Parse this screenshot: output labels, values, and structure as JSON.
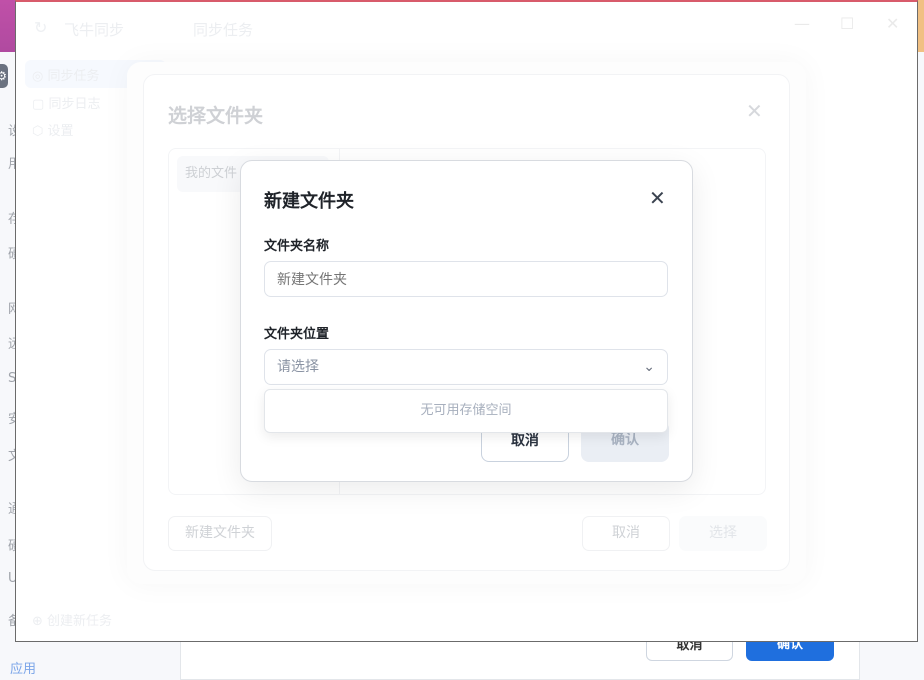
{
  "desktop": {
    "side_chars": [
      "设",
      "用",
      "存",
      "硬",
      "网",
      "远",
      "S",
      "安",
      "文",
      "通",
      "硬",
      "U",
      "备"
    ],
    "gear_icon": "gear-icon",
    "app_link": "应用",
    "back_dialog": {
      "cancel": "取消",
      "confirm": "确认"
    },
    "accent": "#1f6fde"
  },
  "window": {
    "app_name": "飞牛同步",
    "page_title": "同步任务",
    "controls": {
      "minimize": "—",
      "maximize": "☐",
      "close": "✕"
    },
    "sidebar": [
      {
        "label": "同步任务",
        "icon": "◎"
      },
      {
        "label": "同步日志",
        "icon": "▢"
      },
      {
        "label": "设置",
        "icon": "⬡"
      }
    ],
    "create_task": "创建新任务"
  },
  "select_folder_dialog": {
    "title": "选择文件夹",
    "tree_item": "我的文件",
    "new_folder": "新建文件夹",
    "cancel": "取消",
    "select": "选择"
  },
  "new_folder_dialog": {
    "title": "新建文件夹",
    "name_label": "文件夹名称",
    "name_placeholder": "新建文件夹",
    "location_label": "文件夹位置",
    "location_placeholder": "请选择",
    "dropdown_empty": "无可用存储空间",
    "cancel": "取消",
    "confirm": "确认"
  }
}
